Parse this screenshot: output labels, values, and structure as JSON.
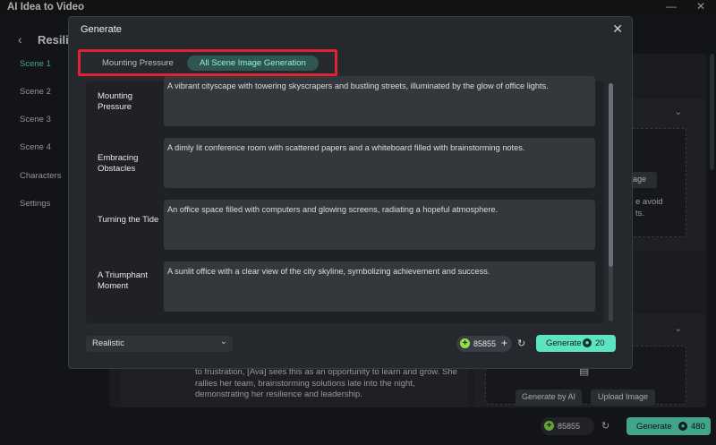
{
  "app": {
    "title": "AI Idea to Video",
    "project_title": "Resilie",
    "back_icon": "arrow-left-icon",
    "window_controls": {
      "minimize": "—",
      "close": "✕"
    }
  },
  "sidebar": {
    "items": [
      {
        "label": "Scene 1",
        "active": true
      },
      {
        "label": "Scene 2",
        "active": false
      },
      {
        "label": "Scene 3",
        "active": false
      },
      {
        "label": "Scene 4",
        "active": false
      },
      {
        "label": "Characters",
        "active": false
      },
      {
        "label": "Settings",
        "active": false
      }
    ]
  },
  "background": {
    "upper_hint_button": "nage",
    "upper_hint_text": "e avoid\nts.",
    "story_text": "to frustration, [Ava] sees this as an opportunity to learn and grow. She rallies her team, brainstorming solutions late into the night, demonstrating her resilience and leadership.",
    "generate_by_ai": "Generate by AI",
    "upload_image": "Upload Image",
    "credits": "85855",
    "generate_label": "Generate",
    "generate_cost": "480"
  },
  "dialog": {
    "title": "Generate",
    "close_icon": "close-icon",
    "tabs": [
      {
        "label": "Mounting Pressure",
        "active": false
      },
      {
        "label": "All Scene Image Generation",
        "active": true
      }
    ],
    "scenes": [
      {
        "name": "Mounting Pressure",
        "prompt": "A vibrant cityscape with towering skyscrapers and bustling streets, illuminated by the glow of office lights."
      },
      {
        "name": "Embracing Obstacles",
        "prompt": "A dimly lit conference room with scattered papers and a whiteboard filled with brainstorming notes."
      },
      {
        "name": "Turning the Tide",
        "prompt": "An office space filled with computers and glowing screens, radiating a hopeful atmosphere."
      },
      {
        "name": "A Triumphant Moment",
        "prompt": "A sunlit office with a clear view of the city skyline, symbolizing achievement and success."
      }
    ],
    "style_select": {
      "value": "Realistic"
    },
    "credits": "85855",
    "generate_label": "Generate",
    "generate_cost": "20"
  },
  "colors": {
    "accent": "#5de3c2",
    "highlight_border": "#e0242f",
    "dialog_bg": "#25282c",
    "app_bg": "#1b1d21"
  }
}
